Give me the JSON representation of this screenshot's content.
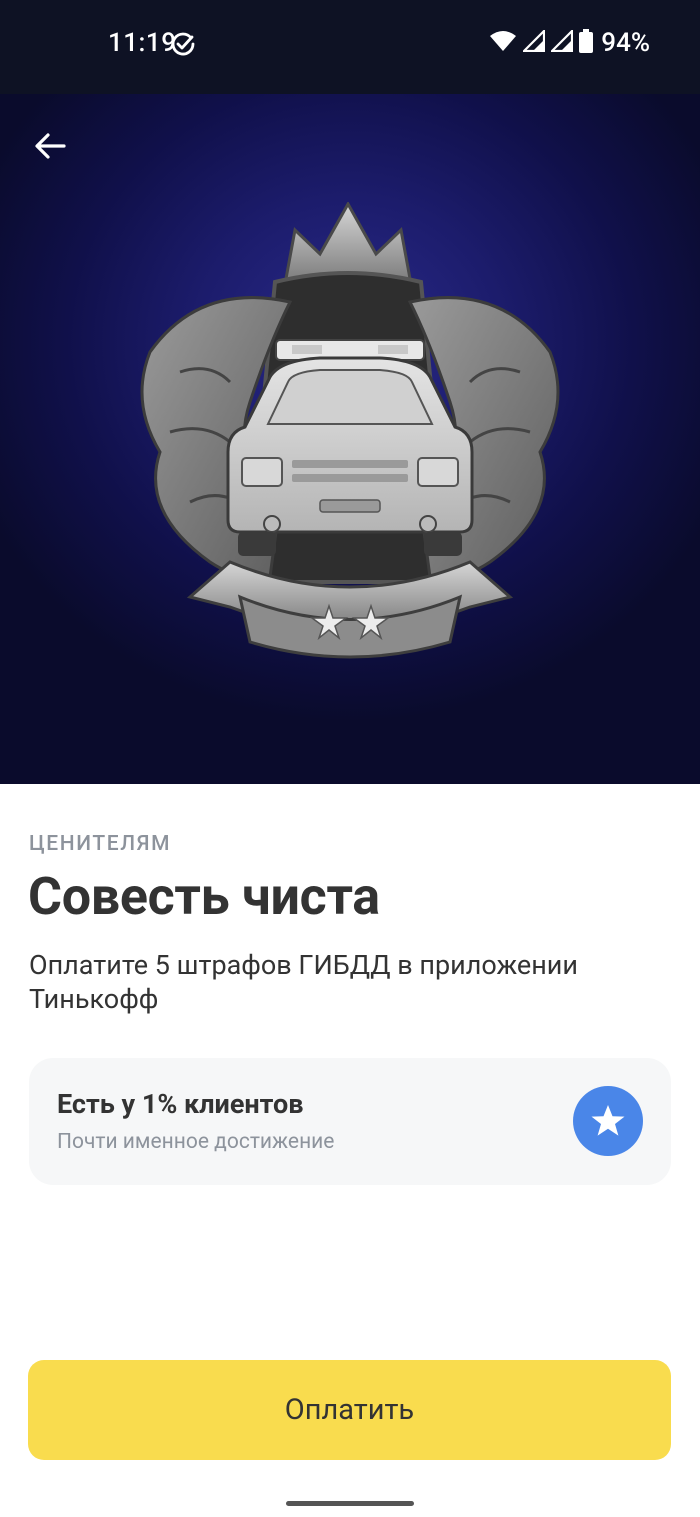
{
  "status_bar": {
    "time": "11:19",
    "battery": "94%"
  },
  "achievement": {
    "category": "ЦЕНИТЕЛЯМ",
    "title": "Совесть чиста",
    "description": "Оплатите 5 штрафов ГИБДД в приложении Тинькофф",
    "badge_icon": "police-car-badge-icon",
    "badge_stars": 2
  },
  "rarity": {
    "title": "Есть у 1% клиентов",
    "subtitle": "Почти именное достижение",
    "icon": "star-icon"
  },
  "actions": {
    "pay_label": "Оплатить"
  },
  "colors": {
    "accent_yellow": "#f9dc4e",
    "star_blue": "#4a86e8",
    "hero_bg": "#1c1c6c"
  }
}
